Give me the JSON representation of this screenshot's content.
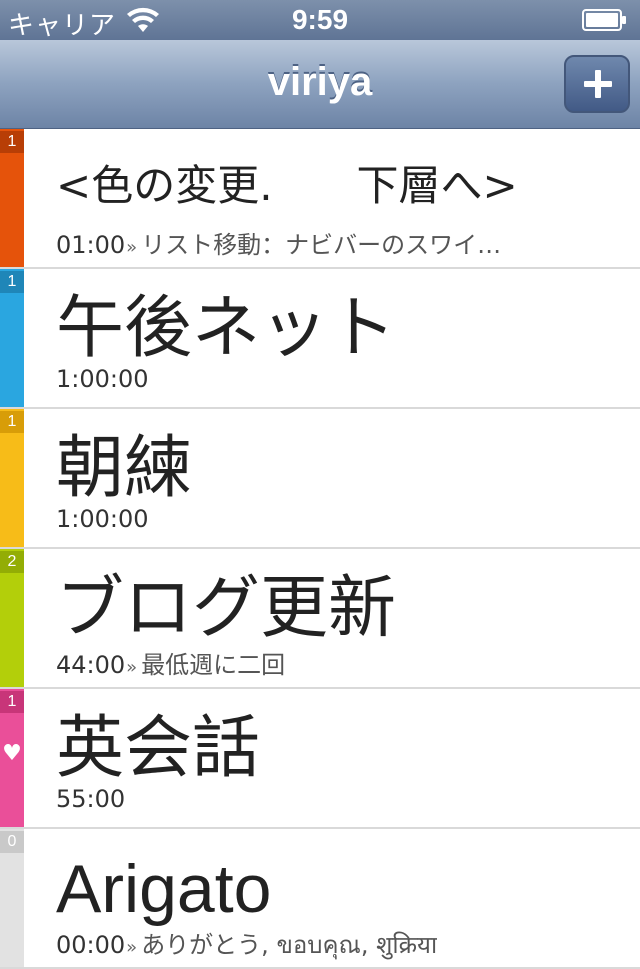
{
  "status_bar": {
    "carrier": "キャリア",
    "time": "9:59"
  },
  "nav": {
    "title": "viriya",
    "add_label": "+"
  },
  "tasks": [
    {
      "title": "<色の変更.　　下層へ>",
      "time": "01:00",
      "note": "リスト移動：ナビバーのスワイ…",
      "count": "1",
      "color": "#e5530b",
      "count_bg": "#b83e06"
    },
    {
      "title": "午後ネット",
      "time": "1:00:00",
      "note": "",
      "count": "1",
      "color": "#2aa6e0",
      "count_bg": "#1f86b8"
    },
    {
      "title": "朝練",
      "time": "1:00:00",
      "note": "",
      "count": "1",
      "color": "#f7bc18",
      "count_bg": "#d89d08"
    },
    {
      "title": "ブログ更新",
      "time": "44:00",
      "note": "最低週に二回",
      "count": "2",
      "color": "#b3cf0a",
      "count_bg": "#93ad05"
    },
    {
      "title": "英会話",
      "time": "55:00",
      "note": "",
      "count": "1",
      "color": "#ea4f99",
      "count_bg": "#c83579",
      "heart": "♥"
    },
    {
      "title": "Arigato",
      "time": "00:00",
      "note": "ありがとう, ขอบคุณ, शुक्रिया",
      "count": "0",
      "color": "#e2e2e2",
      "count_bg": "#c9c9c9"
    }
  ]
}
